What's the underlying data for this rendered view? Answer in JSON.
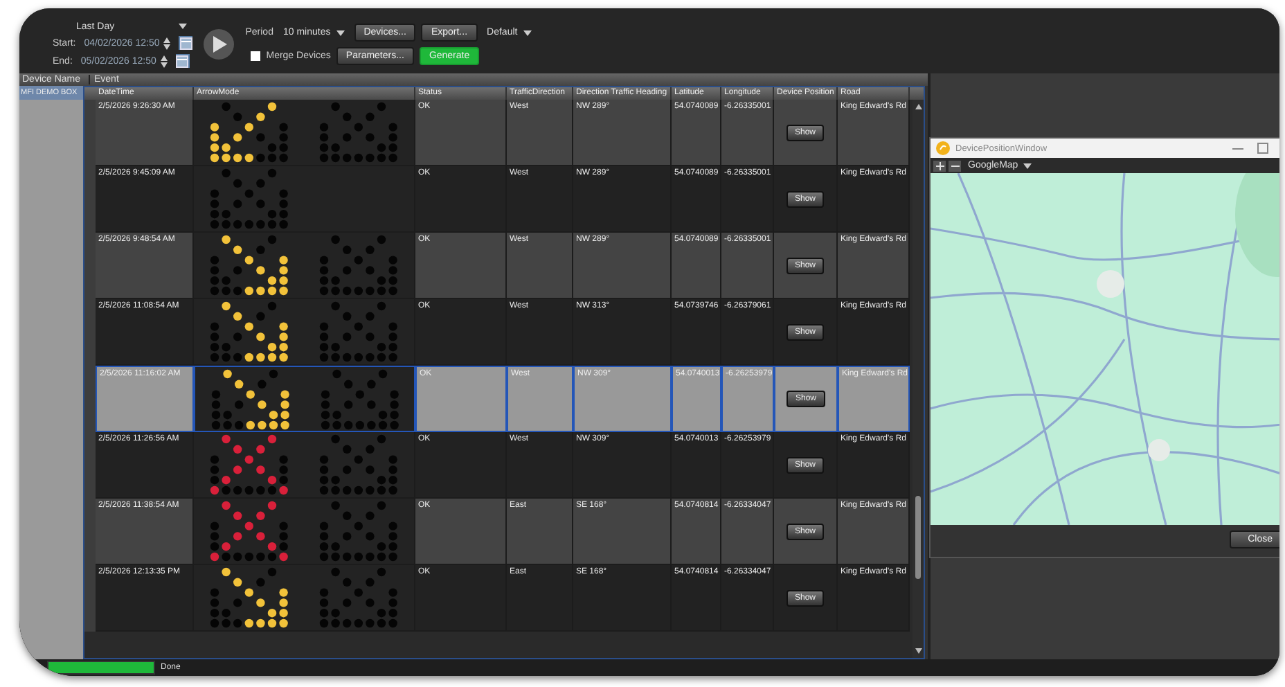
{
  "toolbar": {
    "range": "Last Day",
    "start_label": "Start:",
    "start": "04/02/2026 12:50",
    "end_label": "End:",
    "end": "05/02/2026 12:50",
    "period_label": "Period",
    "period": "10 minutes",
    "devices_button": "Devices...",
    "export_button": "Export...",
    "layout": "Default",
    "merge_devices": {
      "label": "Merge Devices",
      "checked": false
    },
    "parameters_button": "Parameters...",
    "generate_button": "Generate"
  },
  "outer_columns": [
    "Device Name",
    "Event"
  ],
  "devices": [
    {
      "name": "MFI DEMO BOX",
      "selected": true
    }
  ],
  "table": {
    "columns": [
      "DateTime",
      "ArrowMode",
      "Status",
      "TrafficDirection",
      "Direction Traffic Heading",
      "Latitude",
      "Longitude",
      "Device Position",
      "Road"
    ],
    "rows": [
      {
        "datetime": "2/5/2026 9:26:30 AM",
        "signs": [
          {
            "kind": "arrow-down-left",
            "color": "#f2c23a"
          },
          {
            "kind": "blank"
          }
        ],
        "status": "OK",
        "direction": "West",
        "heading": "NW 289°",
        "latitude": "54.0740089",
        "longitude": "-6.26335001",
        "button": "Show",
        "road": "King Edward's Rd",
        "selected": false
      },
      {
        "datetime": "2/5/2026 9:45:09 AM",
        "signs": [
          {
            "kind": "blank"
          }
        ],
        "status": "OK",
        "direction": "West",
        "heading": "NW 289°",
        "latitude": "54.0740089",
        "longitude": "-6.26335001",
        "button": "Show",
        "road": "King Edward's Rd",
        "selected": false
      },
      {
        "datetime": "2/5/2026 9:48:54 AM",
        "signs": [
          {
            "kind": "arrow-down-right",
            "color": "#f2c23a"
          },
          {
            "kind": "blank"
          }
        ],
        "status": "OK",
        "direction": "West",
        "heading": "NW 289°",
        "latitude": "54.0740089",
        "longitude": "-6.26335001",
        "button": "Show",
        "road": "King Edward's Rd",
        "selected": false
      },
      {
        "datetime": "2/5/2026 11:08:54 AM",
        "signs": [
          {
            "kind": "arrow-down-right",
            "color": "#f2c23a"
          },
          {
            "kind": "blank"
          }
        ],
        "status": "OK",
        "direction": "West",
        "heading": "NW 313°",
        "latitude": "54.0739746",
        "longitude": "-6.26379061",
        "button": "Show",
        "road": "King Edward's Rd",
        "selected": false
      },
      {
        "datetime": "2/5/2026 11:16:02 AM",
        "signs": [
          {
            "kind": "arrow-down-right",
            "color": "#f2c23a"
          },
          {
            "kind": "blank"
          }
        ],
        "status": "OK",
        "direction": "West",
        "heading": "NW 309°",
        "latitude": "54.0740013",
        "longitude": "-6.26253979",
        "button": "Show",
        "road": "King Edward's Rd",
        "selected": true
      },
      {
        "datetime": "2/5/2026 11:26:56 AM",
        "signs": [
          {
            "kind": "cross",
            "color": "#d9203a"
          },
          {
            "kind": "blank"
          }
        ],
        "status": "OK",
        "direction": "West",
        "heading": "NW 309°",
        "latitude": "54.0740013",
        "longitude": "-6.26253979",
        "button": "Show",
        "road": "King Edward's Rd",
        "selected": false
      },
      {
        "datetime": "2/5/2026 11:38:54 AM",
        "signs": [
          {
            "kind": "cross",
            "color": "#d9203a"
          },
          {
            "kind": "blank"
          }
        ],
        "status": "OK",
        "direction": "East",
        "heading": "SE 168°",
        "latitude": "54.0740814",
        "longitude": "-6.26334047",
        "button": "Show",
        "road": "King Edward's Rd",
        "selected": false
      },
      {
        "datetime": "2/5/2026 12:13:35 PM",
        "signs": [
          {
            "kind": "arrow-down-right",
            "color": "#f2c23a"
          },
          {
            "kind": "blank"
          }
        ],
        "status": "OK",
        "direction": "East",
        "heading": "SE 168°",
        "latitude": "54.0740814",
        "longitude": "-6.26334047",
        "button": "Show",
        "road": "King Edward's Rd",
        "selected": false
      }
    ]
  },
  "map_window": {
    "title": "DevicePositionWindow",
    "provider": "GoogleMap",
    "close_button": "Close"
  },
  "status_bar": {
    "level": 1,
    "text": "Done"
  }
}
